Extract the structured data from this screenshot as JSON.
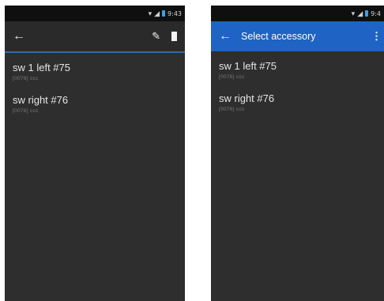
{
  "left_screen": {
    "status": {
      "time": "9:43"
    },
    "toolbar": {
      "back_icon": "back-arrow-icon",
      "edit_icon": "pencil-icon",
      "delete_icon": "trash-icon"
    },
    "items": [
      {
        "title": "sw 1 left #75",
        "subtitle": "[0076] ccc"
      },
      {
        "title": "sw right #76",
        "subtitle": "[0076] ccc"
      }
    ]
  },
  "right_screen": {
    "status": {
      "time": "9:4"
    },
    "toolbar": {
      "title": "Select accessory",
      "back_icon": "back-arrow-icon",
      "overflow_icon": "overflow-menu-icon"
    },
    "items": [
      {
        "title": "sw 1 left #75",
        "subtitle": "[0076] ccc"
      },
      {
        "title": "sw right #76",
        "subtitle": "[0076] ccc"
      }
    ]
  },
  "colors": {
    "accent": "#1f63c4",
    "background": "#2e2e2e",
    "statusbar": "#0f0f0f"
  }
}
